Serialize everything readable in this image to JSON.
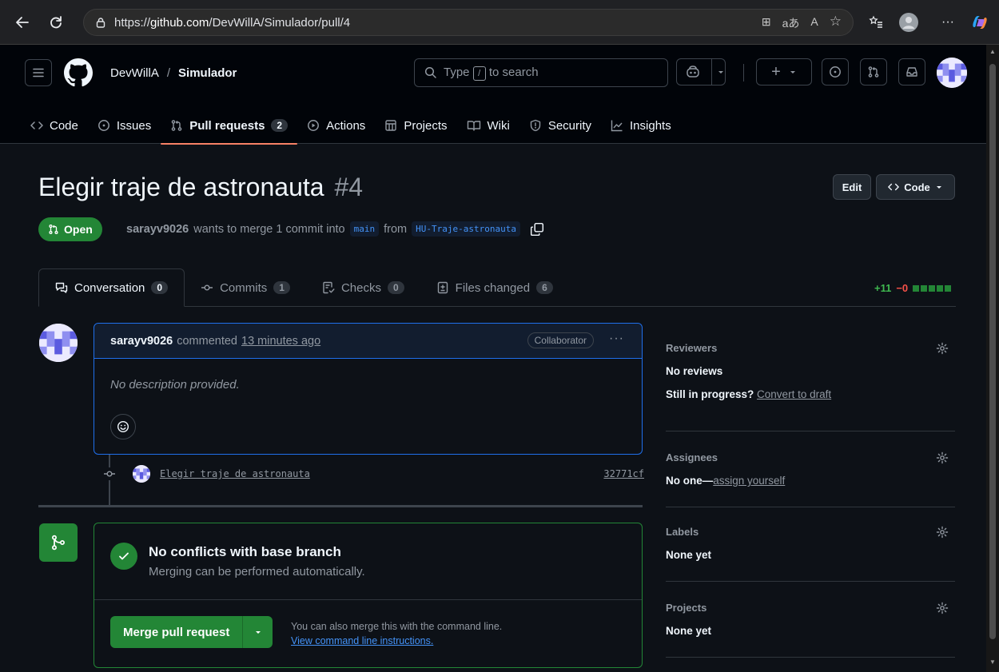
{
  "browser": {
    "url_prefix": "https://",
    "url_host": "github.com",
    "url_path": "/DevWillA/Simulador/pull/4",
    "addr_icons": [
      "⊞",
      "aあ",
      "A",
      "☆"
    ],
    "more": "···"
  },
  "header": {
    "owner": "DevWillA",
    "separator": "/",
    "repo": "Simulador",
    "search_prefix": "Type",
    "search_key": "/",
    "search_suffix": "to search",
    "plus": "+"
  },
  "repo_tabs": [
    {
      "label": "Code",
      "icon": "code-icon"
    },
    {
      "label": "Issues",
      "icon": "issue-icon"
    },
    {
      "label": "Pull requests",
      "icon": "pull-request-icon",
      "count": "2",
      "active": true
    },
    {
      "label": "Actions",
      "icon": "play-icon"
    },
    {
      "label": "Projects",
      "icon": "table-icon"
    },
    {
      "label": "Wiki",
      "icon": "book-icon"
    },
    {
      "label": "Security",
      "icon": "shield-icon"
    },
    {
      "label": "Insights",
      "icon": "graph-icon"
    }
  ],
  "pr": {
    "title": "Elegir traje de astronauta",
    "number": "#4",
    "edit_label": "Edit",
    "code_label": "Code",
    "state": "Open",
    "author": "sarayv9026",
    "meta_text": "wants to merge 1 commit into",
    "base_branch": "main",
    "from_text": "from",
    "head_branch": "HU-Traje-astronauta"
  },
  "pr_tabs": [
    {
      "label": "Conversation",
      "count": "0",
      "active": true
    },
    {
      "label": "Commits",
      "count": "1"
    },
    {
      "label": "Checks",
      "count": "0"
    },
    {
      "label": "Files changed",
      "count": "6"
    }
  ],
  "diffstat": {
    "additions": "+11",
    "deletions": "−0"
  },
  "comment": {
    "author": "sarayv9026",
    "action": "commented",
    "time": "13 minutes ago",
    "role": "Collaborator",
    "body": "No description provided.",
    "more": "···"
  },
  "commit": {
    "message": "Elegir traje de astronauta",
    "sha": "32771cf"
  },
  "merge": {
    "title": "No conflicts with base branch",
    "subtitle": "Merging can be performed automatically.",
    "button": "Merge pull request",
    "help_text": "You can also merge this with the command line.",
    "help_link": "View command line instructions."
  },
  "sidebar": {
    "reviewers": {
      "heading": "Reviewers",
      "value": "No reviews",
      "draft_prefix": "Still in progress?",
      "draft_link": "Convert to draft"
    },
    "assignees": {
      "heading": "Assignees",
      "value_prefix": "No one—",
      "value_link": "assign yourself"
    },
    "labels": {
      "heading": "Labels",
      "value": "None yet"
    },
    "projects": {
      "heading": "Projects",
      "value": "None yet"
    }
  },
  "colors": {
    "accent_green": "#238636",
    "accent_blue": "#1f6feb",
    "tab_underline": "#f78166",
    "link": "#4493f8"
  }
}
